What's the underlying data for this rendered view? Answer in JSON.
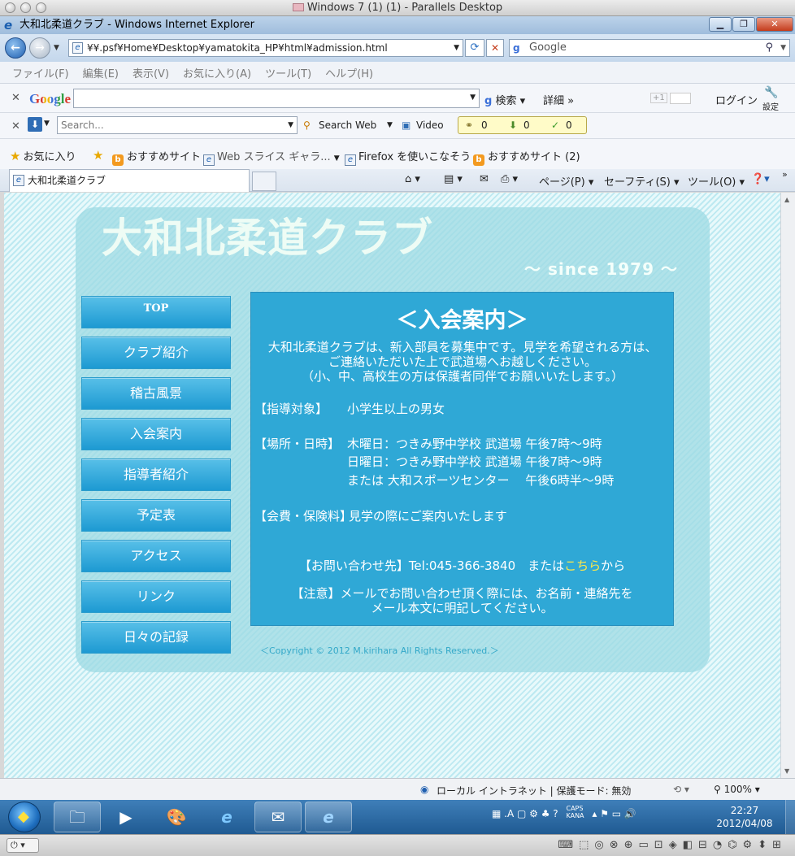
{
  "mac": {
    "title": "Windows 7 (1) (1) - Parallels Desktop"
  },
  "ie": {
    "title": "大和北柔道クラブ - Windows Internet Explorer",
    "address": "¥¥.psf¥Home¥Desktop¥yamatokita_HP¥html¥admission.html",
    "search_engine": "Google",
    "menu": [
      "ファイル(F)",
      "編集(E)",
      "表示(V)",
      "お気に入り(A)",
      "ツール(T)",
      "ヘルプ(H)"
    ],
    "google_toolbar": {
      "logo": "Google",
      "search_label": "検索",
      "more_label": "詳細 »",
      "gplus_label": "+1",
      "login_label": "ログイン",
      "settings_label": "設定"
    },
    "search_toolbar": {
      "placeholder": "Search...",
      "search_web": "Search Web",
      "video": "Video",
      "counters": [
        "0",
        "0",
        "0"
      ]
    },
    "favorites": {
      "label": "お気に入り",
      "items": [
        "おすすめサイト",
        "Web スライス ギャラ...",
        "Firefox を使いこなそう",
        "おすすめサイト (2)"
      ]
    },
    "tab": {
      "title": "大和北柔道クラブ"
    },
    "commands": [
      "ページ(P)",
      "セーフティ(S)",
      "ツール(O)"
    ]
  },
  "site": {
    "title": "大和北柔道クラブ",
    "since": "～ since 1979 ～",
    "nav": [
      "TOP",
      "クラブ紹介",
      "稽古風景",
      "入会案内",
      "指導者紹介",
      "予定表",
      "アクセス",
      "リンク",
      "日々の記録"
    ],
    "content": {
      "heading": "＜入会案内＞",
      "intro": [
        "大和北柔道クラブは、新入部員を募集中です。見学を希望される方は、",
        "ご連絡いただいた上で武道場へお越しください。",
        "（小、中、高校生の方は保護者同伴でお願いいたします。）"
      ],
      "target_label": "【指導対象】",
      "target_value": "小学生以上の男女",
      "place_label": "【場所・日時】",
      "schedule": [
        "木曜日：つきみ野中学校 武道場 午後7時～9時",
        "日曜日：つきみ野中学校 武道場 午後7時～9時",
        "または 大和スポーツセンター　 午後6時半～9時"
      ],
      "fee_label": "【会費・保険料】",
      "fee_value": "見学の際にご案内いたします",
      "contact_pre": "【お問い合わせ先】Tel:045-366-3840　または",
      "contact_link": "こちら",
      "contact_post": "から",
      "notice": [
        "【注意】メールでお問い合わせ頂く際には、お名前・連絡先を",
        "メール本文に明記してください。"
      ]
    },
    "copyright": "＜Copyright © 2012 M.kirihara All Rights Reserved.＞"
  },
  "status": {
    "zone": "ローカル イントラネット | 保護モード: 無効",
    "zoom": "100%"
  },
  "taskbar": {
    "time": "22:27",
    "date": "2012/04/08",
    "caps": "CAPS",
    "kana": "KANA"
  }
}
